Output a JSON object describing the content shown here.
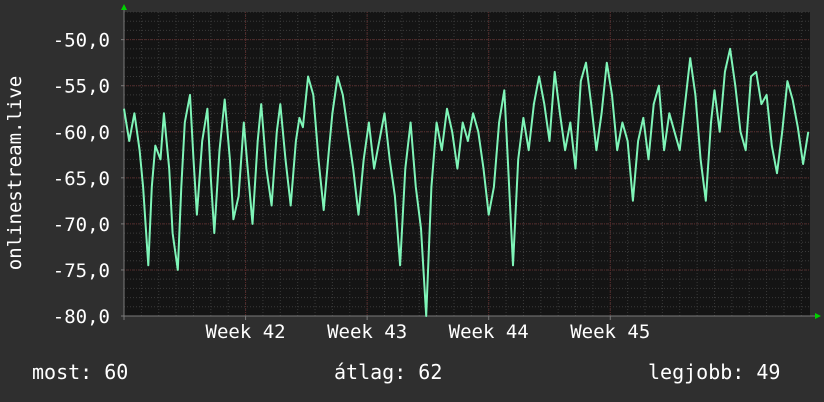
{
  "colors": {
    "background": "#2f2f2f",
    "plot_background": "#141414",
    "grid_minor": "#3a3a3a",
    "grid_major": "#5c2a2a",
    "line": "#7ff5b8",
    "axis": "#7a7a7a",
    "arrow": "#00d000",
    "text": "#ffffff"
  },
  "chart_data": {
    "type": "line",
    "ylabel": "onlinestream.live",
    "xlim": [
      0,
      39.5
    ],
    "ylim": [
      -80.0,
      -47.0
    ],
    "yticks": [
      -50,
      -55,
      -60,
      -65,
      -70,
      -75,
      -80
    ],
    "ytick_labels": [
      "-50,0",
      "-55,0",
      "-60,0",
      "-65,0",
      "-70,0",
      "-75,0",
      "-80,0"
    ],
    "xticks": [
      {
        "label": "Week 42",
        "value": 7
      },
      {
        "label": "Week 43",
        "value": 14
      },
      {
        "label": "Week 44",
        "value": 21
      },
      {
        "label": "Week 45",
        "value": 28
      }
    ],
    "grid": true,
    "series": [
      {
        "values": [
          [
            0.0,
            -57.5
          ],
          [
            0.3,
            -61.0
          ],
          [
            0.6,
            -58.0
          ],
          [
            0.9,
            -62.0
          ],
          [
            1.1,
            -66.0
          ],
          [
            1.4,
            -74.5
          ],
          [
            1.6,
            -66.0
          ],
          [
            1.8,
            -61.5
          ],
          [
            2.1,
            -63.0
          ],
          [
            2.3,
            -58.0
          ],
          [
            2.6,
            -64.0
          ],
          [
            2.8,
            -71.0
          ],
          [
            3.1,
            -75.0
          ],
          [
            3.3,
            -66.0
          ],
          [
            3.5,
            -59.0
          ],
          [
            3.8,
            -56.0
          ],
          [
            4.0,
            -63.0
          ],
          [
            4.2,
            -69.0
          ],
          [
            4.5,
            -61.0
          ],
          [
            4.8,
            -57.5
          ],
          [
            5.0,
            -65.0
          ],
          [
            5.2,
            -71.0
          ],
          [
            5.5,
            -62.0
          ],
          [
            5.8,
            -56.5
          ],
          [
            6.1,
            -63.0
          ],
          [
            6.3,
            -69.5
          ],
          [
            6.6,
            -67.0
          ],
          [
            6.9,
            -59.0
          ],
          [
            7.1,
            -63.5
          ],
          [
            7.4,
            -70.0
          ],
          [
            7.7,
            -61.0
          ],
          [
            7.9,
            -57.0
          ],
          [
            8.2,
            -64.0
          ],
          [
            8.5,
            -68.0
          ],
          [
            8.8,
            -60.0
          ],
          [
            9.0,
            -57.0
          ],
          [
            9.3,
            -63.0
          ],
          [
            9.6,
            -68.0
          ],
          [
            9.9,
            -61.0
          ],
          [
            10.1,
            -58.5
          ],
          [
            10.3,
            -59.5
          ],
          [
            10.6,
            -54.0
          ],
          [
            10.9,
            -56.0
          ],
          [
            11.2,
            -63.0
          ],
          [
            11.5,
            -68.5
          ],
          [
            11.8,
            -62.0
          ],
          [
            12.0,
            -58.0
          ],
          [
            12.3,
            -54.0
          ],
          [
            12.6,
            -56.0
          ],
          [
            12.9,
            -60.0
          ],
          [
            13.2,
            -64.0
          ],
          [
            13.5,
            -69.0
          ],
          [
            13.8,
            -63.0
          ],
          [
            14.1,
            -59.0
          ],
          [
            14.4,
            -64.0
          ],
          [
            14.7,
            -61.0
          ],
          [
            15.0,
            -58.0
          ],
          [
            15.3,
            -63.0
          ],
          [
            15.6,
            -67.0
          ],
          [
            15.9,
            -74.5
          ],
          [
            16.2,
            -64.0
          ],
          [
            16.5,
            -59.0
          ],
          [
            16.8,
            -66.0
          ],
          [
            17.1,
            -70.5
          ],
          [
            17.4,
            -80.0
          ],
          [
            17.7,
            -66.0
          ],
          [
            18.0,
            -59.0
          ],
          [
            18.3,
            -62.0
          ],
          [
            18.6,
            -57.5
          ],
          [
            18.9,
            -60.0
          ],
          [
            19.2,
            -64.0
          ],
          [
            19.5,
            -59.0
          ],
          [
            19.8,
            -61.0
          ],
          [
            20.1,
            -58.0
          ],
          [
            20.4,
            -60.0
          ],
          [
            20.7,
            -64.0
          ],
          [
            21.0,
            -69.0
          ],
          [
            21.3,
            -66.0
          ],
          [
            21.6,
            -59.0
          ],
          [
            21.9,
            -55.5
          ],
          [
            22.1,
            -63.0
          ],
          [
            22.4,
            -74.5
          ],
          [
            22.7,
            -63.0
          ],
          [
            23.0,
            -58.5
          ],
          [
            23.3,
            -62.0
          ],
          [
            23.6,
            -57.0
          ],
          [
            23.9,
            -54.0
          ],
          [
            24.2,
            -57.0
          ],
          [
            24.5,
            -61.0
          ],
          [
            24.8,
            -53.5
          ],
          [
            25.1,
            -58.0
          ],
          [
            25.4,
            -62.0
          ],
          [
            25.7,
            -59.0
          ],
          [
            26.0,
            -64.0
          ],
          [
            26.3,
            -54.5
          ],
          [
            26.6,
            -52.5
          ],
          [
            26.9,
            -57.0
          ],
          [
            27.2,
            -62.0
          ],
          [
            27.5,
            -58.0
          ],
          [
            27.8,
            -52.5
          ],
          [
            28.1,
            -56.0
          ],
          [
            28.4,
            -62.0
          ],
          [
            28.7,
            -59.0
          ],
          [
            29.0,
            -61.0
          ],
          [
            29.3,
            -67.5
          ],
          [
            29.6,
            -61.0
          ],
          [
            29.9,
            -58.5
          ],
          [
            30.2,
            -63.0
          ],
          [
            30.5,
            -57.0
          ],
          [
            30.8,
            -55.0
          ],
          [
            31.1,
            -62.0
          ],
          [
            31.4,
            -58.0
          ],
          [
            31.7,
            -60.0
          ],
          [
            32.0,
            -62.0
          ],
          [
            32.3,
            -57.0
          ],
          [
            32.6,
            -52.0
          ],
          [
            32.9,
            -56.0
          ],
          [
            33.2,
            -63.0
          ],
          [
            33.5,
            -67.5
          ],
          [
            33.8,
            -59.0
          ],
          [
            34.0,
            -55.5
          ],
          [
            34.3,
            -60.0
          ],
          [
            34.6,
            -53.5
          ],
          [
            34.9,
            -51.0
          ],
          [
            35.2,
            -55.0
          ],
          [
            35.5,
            -60.0
          ],
          [
            35.8,
            -62.0
          ],
          [
            36.1,
            -54.0
          ],
          [
            36.4,
            -53.5
          ],
          [
            36.7,
            -57.0
          ],
          [
            37.0,
            -56.0
          ],
          [
            37.3,
            -61.5
          ],
          [
            37.6,
            -64.5
          ],
          [
            37.9,
            -60.0
          ],
          [
            38.2,
            -54.5
          ],
          [
            38.5,
            -56.5
          ],
          [
            38.8,
            -59.5
          ],
          [
            39.1,
            -63.5
          ],
          [
            39.4,
            -60.0
          ]
        ]
      }
    ]
  },
  "stats": {
    "current_label": "most:",
    "current_value": "60",
    "average_label": "átlag:",
    "average_value": "62",
    "best_label": "legjobb:",
    "best_value": "49"
  }
}
